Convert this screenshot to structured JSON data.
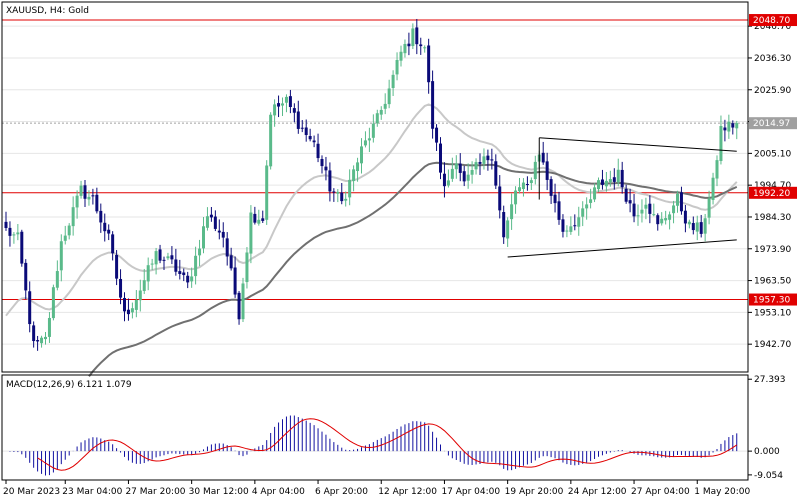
{
  "chart_data": {
    "type": "candlestick",
    "title": "XAUUSD, H4:  Gold",
    "main": {
      "ylim": [
        1933.6,
        2054.6
      ],
      "yticks": [
        2046.7,
        2036.3,
        2025.9,
        2015.5,
        2005.1,
        1994.7,
        1984.3,
        1973.9,
        1963.5,
        1953.1,
        1942.7
      ],
      "ytick_labels": [
        "2046.70",
        "2036.30",
        "2025.90",
        "2015.50",
        "2005.10",
        "1994.70",
        "1984.30",
        "1973.90",
        "1963.50",
        "1953.10",
        "1942.70"
      ],
      "levels": [
        {
          "value": 2048.7,
          "label": "2048.70",
          "color": "#e00000"
        },
        {
          "value": 1992.2,
          "label": "1992.20",
          "color": "#e00000"
        },
        {
          "value": 1957.3,
          "label": "1957.30",
          "color": "#e00000"
        }
      ],
      "current_price": {
        "value": 2014.97,
        "label": "2014.97",
        "color": "#a0a0a0"
      },
      "triangle": {
        "upper": [
          {
            "bar": 135,
            "price": 2010.2
          },
          {
            "bar": 185,
            "price": 2005.8
          }
        ],
        "lower": [
          {
            "bar": 127,
            "price": 1971.2
          },
          {
            "bar": 185,
            "price": 1976.8
          }
        ],
        "start_vertical": {
          "bar": 135,
          "from": 2010.2,
          "to": 1990.0
        }
      },
      "bull_color": "#5aba8a",
      "bear_color": "#0a0a78",
      "ma_fast_color": "#c8c8c8",
      "ma_slow_color": "#707070"
    },
    "macd": {
      "label": "MACD(12,26,9) 6.121 1.079",
      "ylim": [
        -11.0,
        29.0
      ],
      "yticks": [
        27.393,
        0.0,
        -9.054
      ],
      "ytick_labels": [
        "27.393",
        "0.000",
        "-9.054"
      ],
      "hist_color": "#1010a0",
      "signal_color": "#e00000"
    },
    "x_labels": [
      "20 Mar 2023",
      "23 Mar 04:00",
      "27 Mar 20:00",
      "30 Mar 12:00",
      "4 Apr 04:00",
      "6 Apr 20:00",
      "12 Apr 12:00",
      "17 Apr 04:00",
      "19 Apr 20:00",
      "24 Apr 12:00",
      "27 Apr 04:00",
      "1 May 20:00"
    ],
    "x_label_bars": [
      0,
      15,
      31,
      47,
      63,
      79,
      95,
      111,
      127,
      143,
      159,
      175
    ],
    "anchors": [
      {
        "bar": 0,
        "price": 1980
      },
      {
        "bar": 3,
        "price": 1977
      },
      {
        "bar": 7,
        "price": 1942
      },
      {
        "bar": 10,
        "price": 1944
      },
      {
        "bar": 14,
        "price": 1976
      },
      {
        "bar": 19,
        "price": 1993
      },
      {
        "bar": 22,
        "price": 1990
      },
      {
        "bar": 26,
        "price": 1977
      },
      {
        "bar": 30,
        "price": 1952
      },
      {
        "bar": 33,
        "price": 1958
      },
      {
        "bar": 38,
        "price": 1972
      },
      {
        "bar": 42,
        "price": 1969
      },
      {
        "bar": 46,
        "price": 1962
      },
      {
        "bar": 51,
        "price": 1985
      },
      {
        "bar": 55,
        "price": 1978
      },
      {
        "bar": 59,
        "price": 1953
      },
      {
        "bar": 62,
        "price": 1985
      },
      {
        "bar": 65,
        "price": 1984
      },
      {
        "bar": 67,
        "price": 2019
      },
      {
        "bar": 71,
        "price": 2022
      },
      {
        "bar": 75,
        "price": 2013
      },
      {
        "bar": 78,
        "price": 2008
      },
      {
        "bar": 82,
        "price": 1994
      },
      {
        "bar": 85,
        "price": 1989
      },
      {
        "bar": 90,
        "price": 2006
      },
      {
        "bar": 94,
        "price": 2016
      },
      {
        "bar": 97,
        "price": 2026
      },
      {
        "bar": 100,
        "price": 2038
      },
      {
        "bar": 103,
        "price": 2044
      },
      {
        "bar": 106,
        "price": 2040
      },
      {
        "bar": 108,
        "price": 2014
      },
      {
        "bar": 111,
        "price": 1993
      },
      {
        "bar": 114,
        "price": 2004
      },
      {
        "bar": 116,
        "price": 1995
      },
      {
        "bar": 119,
        "price": 2000
      },
      {
        "bar": 123,
        "price": 2005
      },
      {
        "bar": 126,
        "price": 1977
      },
      {
        "bar": 129,
        "price": 1993
      },
      {
        "bar": 132,
        "price": 1994
      },
      {
        "bar": 135,
        "price": 2006
      },
      {
        "bar": 138,
        "price": 1992
      },
      {
        "bar": 141,
        "price": 1980
      },
      {
        "bar": 146,
        "price": 1985
      },
      {
        "bar": 150,
        "price": 1995
      },
      {
        "bar": 155,
        "price": 1998
      },
      {
        "bar": 159,
        "price": 1985
      },
      {
        "bar": 162,
        "price": 1990
      },
      {
        "bar": 165,
        "price": 1981
      },
      {
        "bar": 170,
        "price": 1990
      },
      {
        "bar": 173,
        "price": 1981
      },
      {
        "bar": 176,
        "price": 1980
      },
      {
        "bar": 179,
        "price": 1995
      },
      {
        "bar": 181,
        "price": 2013
      },
      {
        "bar": 185,
        "price": 2015
      }
    ]
  }
}
